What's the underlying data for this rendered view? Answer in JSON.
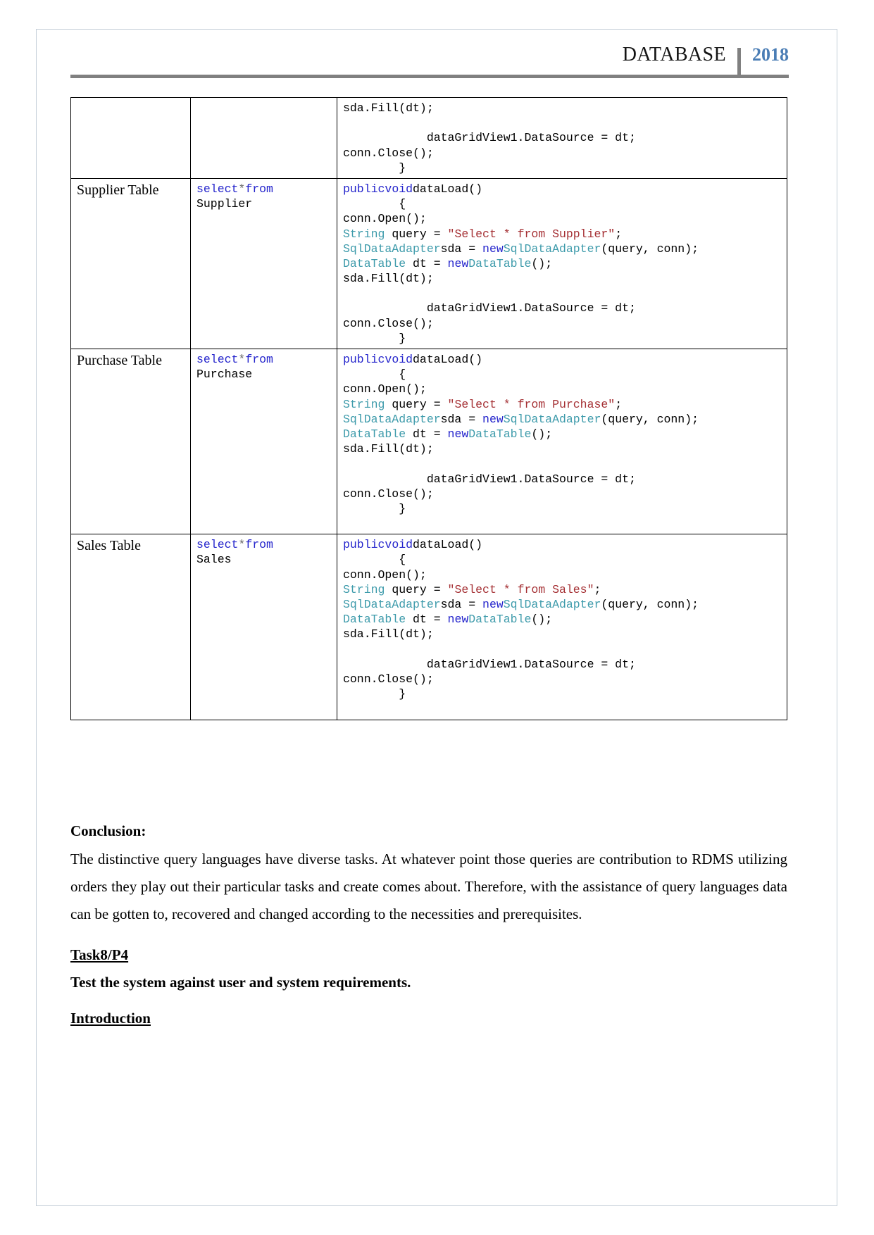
{
  "header": {
    "title": "DATABASE",
    "year": "2018",
    "divider_color": "#808080",
    "year_color": "#4a7db5"
  },
  "table": {
    "rows": [
      {
        "label": "",
        "sql": "",
        "code_lines": [
          [
            {
              "t": "sda.Fill(dt);",
              "c": "plain"
            }
          ],
          [
            {
              "t": "",
              "c": "plain"
            }
          ],
          [
            {
              "t": "            dataGridView1.DataSource = dt;",
              "c": "plain"
            }
          ],
          [
            {
              "t": "conn.Close();",
              "c": "plain"
            }
          ],
          [
            {
              "t": "        }",
              "c": "plain"
            }
          ]
        ]
      },
      {
        "label": "Supplier Table",
        "sql_lines": [
          [
            {
              "t": "select",
              "c": "kw"
            },
            {
              "t": "*",
              "c": "op"
            },
            {
              "t": "from",
              "c": "kw"
            }
          ],
          [
            {
              "t": "Supplier",
              "c": "plain"
            }
          ]
        ],
        "code_lines": [
          [
            {
              "t": "public",
              "c": "kw"
            },
            {
              "t": "void",
              "c": "kw"
            },
            {
              "t": "dataLoad()",
              "c": "plain"
            }
          ],
          [
            {
              "t": "        {",
              "c": "plain"
            }
          ],
          [
            {
              "t": "conn.Open();",
              "c": "plain"
            }
          ],
          [
            {
              "t": "String",
              "c": "ty"
            },
            {
              "t": " query = ",
              "c": "plain"
            },
            {
              "t": "\"Select * from Supplier\"",
              "c": "st"
            },
            {
              "t": ";",
              "c": "plain"
            }
          ],
          [
            {
              "t": "SqlDataAdapter",
              "c": "ty"
            },
            {
              "t": "sda = ",
              "c": "plain"
            },
            {
              "t": "new",
              "c": "kw"
            },
            {
              "t": "SqlDataAdapter",
              "c": "ty"
            },
            {
              "t": "(query, conn);",
              "c": "plain"
            }
          ],
          [
            {
              "t": "DataTable",
              "c": "ty"
            },
            {
              "t": " dt = ",
              "c": "plain"
            },
            {
              "t": "new",
              "c": "kw"
            },
            {
              "t": "DataTable",
              "c": "ty"
            },
            {
              "t": "();",
              "c": "plain"
            }
          ],
          [
            {
              "t": "sda.Fill(dt);",
              "c": "plain"
            }
          ],
          [
            {
              "t": "",
              "c": "plain"
            }
          ],
          [
            {
              "t": "            dataGridView1.DataSource = dt;",
              "c": "plain"
            }
          ],
          [
            {
              "t": "conn.Close();",
              "c": "plain"
            }
          ],
          [
            {
              "t": "        }",
              "c": "plain"
            }
          ]
        ]
      },
      {
        "label": "Purchase Table",
        "sql_lines": [
          [
            {
              "t": "select",
              "c": "kw"
            },
            {
              "t": "*",
              "c": "op"
            },
            {
              "t": "from",
              "c": "kw"
            }
          ],
          [
            {
              "t": "Purchase",
              "c": "plain"
            }
          ]
        ],
        "code_lines": [
          [
            {
              "t": "public",
              "c": "kw"
            },
            {
              "t": "void",
              "c": "kw"
            },
            {
              "t": "dataLoad()",
              "c": "plain"
            }
          ],
          [
            {
              "t": "        {",
              "c": "plain"
            }
          ],
          [
            {
              "t": "conn.Open();",
              "c": "plain"
            }
          ],
          [
            {
              "t": "String",
              "c": "ty"
            },
            {
              "t": " query = ",
              "c": "plain"
            },
            {
              "t": "\"Select * from Purchase\"",
              "c": "st"
            },
            {
              "t": ";",
              "c": "plain"
            }
          ],
          [
            {
              "t": "SqlDataAdapter",
              "c": "ty"
            },
            {
              "t": "sda = ",
              "c": "plain"
            },
            {
              "t": "new",
              "c": "kw"
            },
            {
              "t": "SqlDataAdapter",
              "c": "ty"
            },
            {
              "t": "(query, conn);",
              "c": "plain"
            }
          ],
          [
            {
              "t": "DataTable",
              "c": "ty"
            },
            {
              "t": " dt = ",
              "c": "plain"
            },
            {
              "t": "new",
              "c": "kw"
            },
            {
              "t": "DataTable",
              "c": "ty"
            },
            {
              "t": "();",
              "c": "plain"
            }
          ],
          [
            {
              "t": "sda.Fill(dt);",
              "c": "plain"
            }
          ],
          [
            {
              "t": "",
              "c": "plain"
            }
          ],
          [
            {
              "t": "            dataGridView1.DataSource = dt;",
              "c": "plain"
            }
          ],
          [
            {
              "t": "conn.Close();",
              "c": "plain"
            }
          ],
          [
            {
              "t": "        }",
              "c": "plain"
            }
          ],
          [
            {
              "t": "",
              "c": "plain"
            }
          ]
        ]
      },
      {
        "label": "Sales Table",
        "sql_lines": [
          [
            {
              "t": "select",
              "c": "kw"
            },
            {
              "t": "*",
              "c": "op"
            },
            {
              "t": "from",
              "c": "kw"
            }
          ],
          [
            {
              "t": "Sales",
              "c": "plain"
            }
          ]
        ],
        "code_lines": [
          [
            {
              "t": "public",
              "c": "kw"
            },
            {
              "t": "void",
              "c": "kw"
            },
            {
              "t": "dataLoad()",
              "c": "plain"
            }
          ],
          [
            {
              "t": "        {",
              "c": "plain"
            }
          ],
          [
            {
              "t": "conn.Open();",
              "c": "plain"
            }
          ],
          [
            {
              "t": "String",
              "c": "ty"
            },
            {
              "t": " query = ",
              "c": "plain"
            },
            {
              "t": "\"Select * from Sales\"",
              "c": "st"
            },
            {
              "t": ";",
              "c": "plain"
            }
          ],
          [
            {
              "t": "SqlDataAdapter",
              "c": "ty"
            },
            {
              "t": "sda = ",
              "c": "plain"
            },
            {
              "t": "new",
              "c": "kw"
            },
            {
              "t": "SqlDataAdapter",
              "c": "ty"
            },
            {
              "t": "(query, conn);",
              "c": "plain"
            }
          ],
          [
            {
              "t": "DataTable",
              "c": "ty"
            },
            {
              "t": " dt = ",
              "c": "plain"
            },
            {
              "t": "new",
              "c": "kw"
            },
            {
              "t": "DataTable",
              "c": "ty"
            },
            {
              "t": "();",
              "c": "plain"
            }
          ],
          [
            {
              "t": "sda.Fill(dt);",
              "c": "plain"
            }
          ],
          [
            {
              "t": "",
              "c": "plain"
            }
          ],
          [
            {
              "t": "            dataGridView1.DataSource = dt;",
              "c": "plain"
            }
          ],
          [
            {
              "t": "conn.Close();",
              "c": "plain"
            }
          ],
          [
            {
              "t": "        }",
              "c": "plain"
            }
          ],
          [
            {
              "t": "",
              "c": "plain"
            }
          ]
        ]
      }
    ]
  },
  "body": {
    "conclusion_heading": "Conclusion:",
    "conclusion_text": "The distinctive query languages have diverse tasks. At whatever point those queries are contribution to RDMS utilizing orders they play out their particular tasks and create comes about. Therefore, with the assistance of query languages data can be gotten to, recovered and changed according to the necessities and prerequisites.",
    "task_heading": "Task8/P4",
    "task_subtitle": "Test the system against user and system requirements.",
    "introduction_heading": "Introduction"
  },
  "colors": {
    "keyword": "#2424cc",
    "type": "#3e9bab",
    "string": "#a53034",
    "operator": "#6b6b6b",
    "page_border": "#c3ced8",
    "rule": "#808080"
  }
}
